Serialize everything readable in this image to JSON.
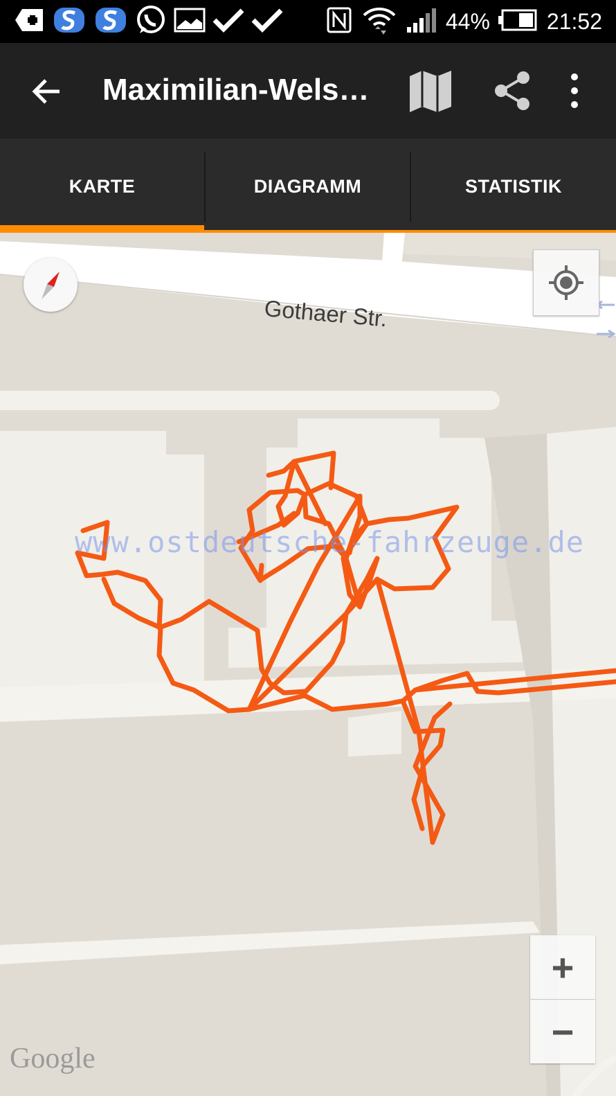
{
  "status_bar": {
    "battery_percent": "44%",
    "time": "21:52",
    "icons": [
      "add-box-icon",
      "sync-icon",
      "sync-icon",
      "whatsapp-icon",
      "gallery-icon",
      "check-icon",
      "check-icon",
      "nfc-icon",
      "wifi-icon",
      "signal-icon",
      "battery-icon"
    ]
  },
  "toolbar": {
    "title": "Maximilian-Wels…",
    "back_icon": "arrow-left-icon",
    "map_icon": "map-icon",
    "share_icon": "share-icon",
    "more_icon": "more-vert-icon"
  },
  "tabs": [
    {
      "label": "KARTE",
      "active": true
    },
    {
      "label": "DIAGRAMM",
      "active": false
    },
    {
      "label": "STATISTIK",
      "active": false
    }
  ],
  "map": {
    "street_name": "Gothaer Str.",
    "watermark": "www.ostdeutsche-fahrzeuge.de",
    "attribution": "Google",
    "zoom_in_label": "+",
    "zoom_out_label": "−",
    "track_color": "#f45a14",
    "accent_color": "#ff8c00"
  }
}
